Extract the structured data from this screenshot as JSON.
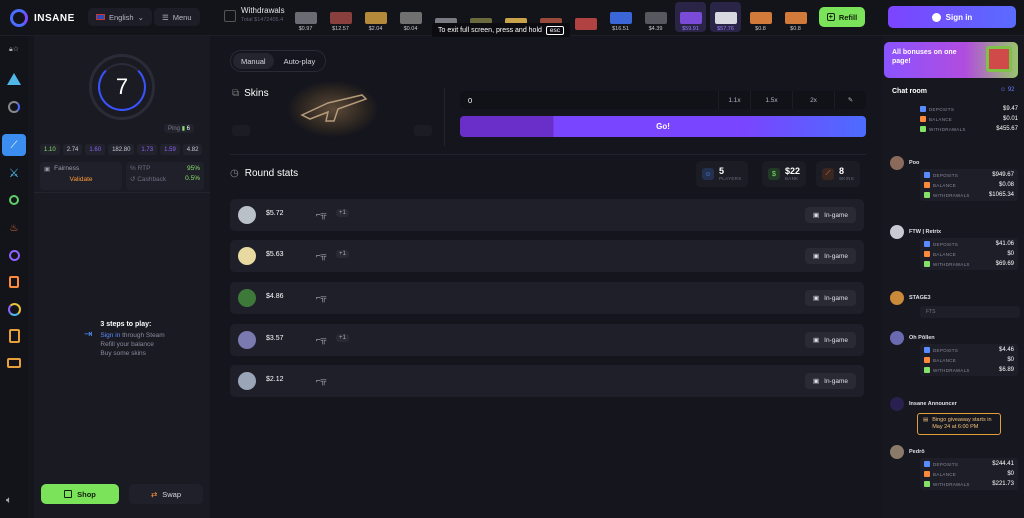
{
  "app": {
    "name": "INSANE"
  },
  "header": {
    "language": "English",
    "menu_label": "Menu",
    "withdrawals_title": "Withdrawals",
    "withdrawals_sub": "Total $1472405.4",
    "refill_label": "Refill",
    "signin_label": "Sign in",
    "toast_text": "To exit full screen, press and hold",
    "toast_key": "esc",
    "strip": [
      {
        "price": "$0.97",
        "color": "#6b6b74"
      },
      {
        "price": "$12.57",
        "color": "#8a3f3f"
      },
      {
        "price": "$2.04",
        "color": "#b48a3a"
      },
      {
        "price": "$0.04",
        "color": "#707070"
      },
      {
        "price": "",
        "color": "#7a7a82"
      },
      {
        "price": "",
        "color": "#6a6a3e"
      },
      {
        "price": "",
        "color": "#c9a34a"
      },
      {
        "price": "",
        "color": "#9a4a3a"
      },
      {
        "price": "",
        "color": "#b04242"
      },
      {
        "price": "$16.51",
        "color": "#3b66d8"
      },
      {
        "price": "$4.39",
        "color": "#575760"
      },
      {
        "price": "$59.91",
        "color": "#7a4ad8"
      },
      {
        "price": "$57.76",
        "color": "#d8d8e0"
      },
      {
        "price": "$0.8",
        "color": "#d17a3a"
      },
      {
        "price": "$0.8",
        "color": "#d17a3a"
      }
    ]
  },
  "left": {
    "wheel_value": "7",
    "ping_label": "Ping",
    "ping_value": "6",
    "multipliers": [
      {
        "v": "1.10",
        "c": "#86e36a"
      },
      {
        "v": "2.74",
        "c": "#c9c9d4"
      },
      {
        "v": "1.60",
        "c": "#8c63ff"
      },
      {
        "v": "182.80",
        "c": "#c9c9d4"
      },
      {
        "v": "1.73",
        "c": "#8c63ff"
      },
      {
        "v": "1.59",
        "c": "#8c63ff"
      },
      {
        "v": "4.82",
        "c": "#c9c9d4"
      }
    ],
    "fairness_label": "Fairness",
    "validate_label": "Validate",
    "rtp_label": "RTP",
    "rtp_value": "95%",
    "cashback_label": "Cashback",
    "cashback_value": "0.5%",
    "steps_title": "3 steps to play:",
    "step1_link": "Sign in",
    "step1_rest": " through Steam",
    "step2": "Refill your balance",
    "step3": "Buy some skins",
    "shop_label": "Shop",
    "swap_label": "Swap"
  },
  "main": {
    "tab_manual": "Manual",
    "tab_auto": "Auto-play",
    "skins_label": "Skins",
    "bet_value": "0",
    "quick": [
      "1.1x",
      "1.5x",
      "2x"
    ],
    "go_label": "Go!",
    "round_stats_label": "Round stats",
    "stats": [
      {
        "n": "5",
        "lb": "PLAYERS"
      },
      {
        "n": "$22",
        "lb": "BANK"
      },
      {
        "n": "8",
        "lb": "SKINS"
      }
    ],
    "rows": [
      {
        "amount": "$5.72",
        "extra": "+1",
        "avatar": "#b9c0c8",
        "status": "In-game"
      },
      {
        "amount": "$5.63",
        "extra": "+1",
        "avatar": "#e8d9a0",
        "status": "In-game"
      },
      {
        "amount": "$4.86",
        "extra": "",
        "avatar": "#3d7a3a",
        "status": "In-game"
      },
      {
        "amount": "$3.57",
        "extra": "+1",
        "avatar": "#7a7ab0",
        "status": "In-game"
      },
      {
        "amount": "$2.12",
        "extra": "",
        "avatar": "#9aa6b8",
        "status": "In-game"
      }
    ]
  },
  "chat": {
    "banner_text": "All bonuses on one page!",
    "title": "Chat room",
    "users_count": "92",
    "deposits_label": "DEPOSITS",
    "balance_label": "BALANCE",
    "withdrawals_label": "WITHDRAWALS",
    "first": {
      "deposits": "$9.47",
      "balance": "$0.01",
      "withdrawals": "$455.67"
    },
    "messages": [
      {
        "name": "Poo",
        "avatar": "#8a6a5a",
        "deposits": "$949.67",
        "balance": "$0.08",
        "withdrawals": "$1065.34"
      },
      {
        "name": "FTW | Retrix",
        "avatar": "#c9c9d4",
        "deposits": "$41.06",
        "balance": "$0",
        "withdrawals": "$69.69"
      }
    ],
    "stage_name": "STAGE3",
    "stage_text": "FTS",
    "messages2": [
      {
        "name": "Oh Põllen",
        "avatar": "#6a6ab0",
        "deposits": "$4.46",
        "balance": "$0",
        "withdrawals": "$6.89"
      }
    ],
    "announcer_name": "Insane Announcer",
    "announcer_text": "Bingo giveaway starts in May 24 at 6:00 PM",
    "last": {
      "name": "Pedrö",
      "avatar": "#8a7a6a",
      "deposits": "$244.41",
      "balance": "$0",
      "withdrawals": "$221.73"
    }
  }
}
